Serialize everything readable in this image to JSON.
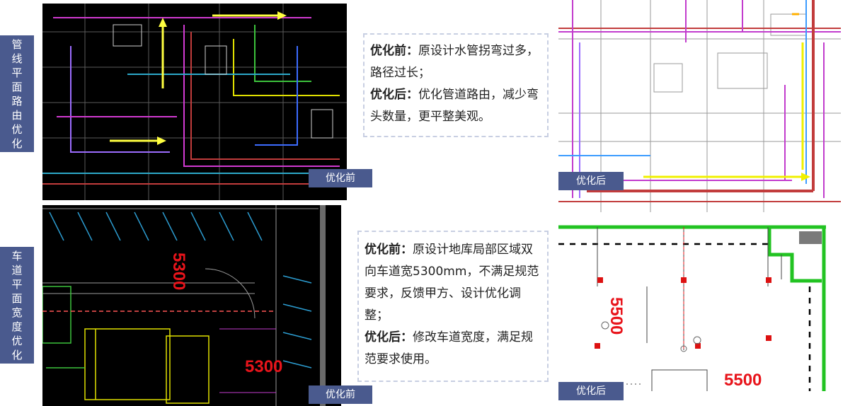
{
  "sections": {
    "pipe": {
      "label": "管线平面路由优化",
      "before_tag": "优化前",
      "after_tag": "优化后",
      "note": {
        "before_heading": "优化前：",
        "before_text": "原设计水管拐弯过多，路径过长；",
        "after_heading": "优化后：",
        "after_text": "优化管道路由，减少弯头数量，更平整美观。"
      }
    },
    "lane": {
      "label": "车道平面宽度优化",
      "before_tag": "优化前",
      "after_tag": "优化后",
      "before_dims": [
        "5300",
        "5300"
      ],
      "after_dims": [
        "5500",
        "5500"
      ],
      "note": {
        "before_heading": "优化前：",
        "before_text": "原设计地库局部区域双向车道宽5300mm，不满足规范要求，反馈甲方、设计优化调整；",
        "after_heading": "优化后：",
        "after_text": "修改车道宽度，满足规范要求使用。"
      }
    }
  },
  "colors": {
    "label_bg": "#4a5a8e",
    "dim_red": "#e8141b",
    "lane_green": "#22c322"
  }
}
